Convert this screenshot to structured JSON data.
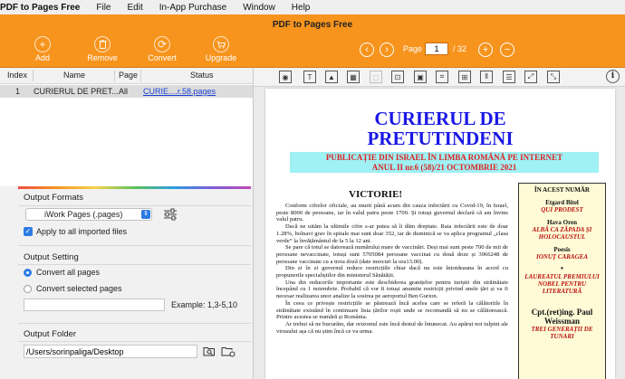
{
  "menubar": {
    "app_name": "PDF to Pages Free",
    "items": [
      "File",
      "Edit",
      "In-App Purchase",
      "Window",
      "Help"
    ]
  },
  "window": {
    "title": "PDF to Pages Free"
  },
  "toolbar": {
    "add": "Add",
    "remove": "Remove",
    "convert": "Convert",
    "upgrade": "Upgrade",
    "page_label": "Page",
    "page_value": "1",
    "page_total": "/ 32"
  },
  "file_table": {
    "headers": [
      "Index",
      "Name",
      "Page",
      "Status"
    ],
    "rows": [
      {
        "index": "1",
        "name": "CURIERUL DE PRET...",
        "page": "All",
        "status": "CURIE....r.58.pages"
      }
    ]
  },
  "output_formats": {
    "title": "Output Formats",
    "selected": "iWork Pages (.pages)",
    "apply_all_label": "Apply to all imported files",
    "apply_all_checked": true
  },
  "output_setting": {
    "title": "Output Setting",
    "convert_all": "Convert all pages",
    "convert_selected": "Convert selected pages",
    "example": "Example: 1,3-5,10"
  },
  "output_folder": {
    "title": "Output Folder",
    "path": "/Users/sorinpaliga/Desktop"
  },
  "document": {
    "title_line1": "CURIERUL DE",
    "title_line2": "PRETUTINDENI",
    "subtitle_line1": "PUBLICAȚIE DIN ISRAEL ÎN LIMBA ROMÂNĂ PE INTERNET",
    "subtitle_line2": "ANUL  II  nr.6 (58)/21 OCTOMBRIE 2021",
    "article_title": "VICTORIE!",
    "paragraphs": [
      "Conform cifrelor oficiale, au murit până acum din cauza infectării cu Covid-19, în Israel, peste 8000 de persoane, iar în valul patru peste 1700. Și totuși guvernul declară că am învins valul patru.",
      "Dacă ne uităm la ultimile cifre s-ar putea să îi dăm dreptate. Rata infectării este de doar 1.28%, bolnavi grav în spitale mai sunt doar 352, iar de duminică se va aplica programul „clasa verde” la învățământul de la 5 la 12 ani.",
      "Se pare că totul se datorează numărului mare de vaccinări. Deși mai sunt peste 700 de mii de persoane nevaccinate, totuși sunt 5705084 persoane vaccinat cu două doze și 3966248 de persoane vaccinate cu a treia doză (date mercuri la ora13.00).",
      "Din zi în zi guvernul reduce restricțiile chiar dacă nu este întotdeauna în acord cu propunerile specialiștilor din ministerul Sănătății.",
      "Una din reducerile importante este deschiderea granițelor pentru turiștii din străinătate începând cu 1 noiembrie. Probabil că vor fi totuși anumite restricții privind unele țări și va fi necesar realizarea unor analize la sosirea pe aeroportul Ben Gurion.",
      "În ceea ce privește restricțiile se păstrează încă acelea care se referă la călătoriile în străinătate existând în continuare lista țărilor roșii unde se recomandă să nu se călătorească. Printre acestea se numără și România.",
      "Ar trebui să ne bucurăm, dar orizontul este încă destul de întunecat. Au apărut noi tulpini ale virusului așa că nu știm încă ce va urma."
    ],
    "sidebox": {
      "heading": "ÎN ACEST NUMĂR",
      "a1_name": "Etgard Bitel",
      "a1_title": "QUI PRODEST",
      "a2_name": "Hava Oren",
      "a2_title": "ALBĂ CA ZĂPADA ȘI HOLOCAUSTUL",
      "a3_name": "Poesis",
      "a3_title": "IONUȚ CARAGEA",
      "star": "*",
      "a4_title": "LAUREATUL PREMIULUI NOBEL PENTRU LITERATURĂ",
      "a5_name": "Cpt.(ret)ing. Paul Weissman",
      "a5_title": "TREI GENERAȚII DE TUNARI"
    }
  }
}
